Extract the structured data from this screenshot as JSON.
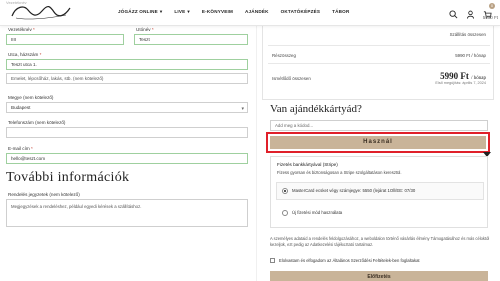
{
  "header": {
    "ghost_label": "Vezetéknév",
    "nav": [
      "JÓGÁZZ ONLINE",
      "LIVE",
      "E-KÖNYVEIM",
      "AJÁNDÉK",
      "OKTATÓKÉPZÉS",
      "TÁBOR"
    ],
    "nav_dropdowns": [
      true,
      true,
      false,
      false,
      false,
      false
    ],
    "cart_count": "0",
    "cart_total": "5990 Ft",
    "icons": [
      "search-icon",
      "user-icon",
      "cart-icon"
    ]
  },
  "form": {
    "lastname_label": "Vezetéknév",
    "firstname_label": "Utónév",
    "lastname_value": "IIII",
    "firstname_value": "Teszt",
    "address_label": "Utca, házszám",
    "address_value": "Teszt utca 1.",
    "address2_placeholder": "Emelet, lépcsőház, lakás, stb. (nem kötelező)",
    "county_label": "Megye (nem kötelező)",
    "county_value": "Budapest",
    "phone_label": "Telefonszám (nem kötelező)",
    "phone_value": "",
    "email_label": "E-mail cím",
    "email_value": "hello@teszt.com",
    "required_mark": "*",
    "section_title": "További információk",
    "notes_label": "Rendelés jegyzetek (nem kötelező)",
    "notes_placeholder": "Megjegyzések a rendeléshez, például egyedi kérések a szállításhoz."
  },
  "summary": {
    "shipping_label": "Szállítás összesen",
    "subscription_label": "Részösszeg",
    "subscription_value": "5990 Ft / hónap",
    "recurring_label": "Ismétlődő összesen",
    "recurring_value": "5990 Ft",
    "recurring_unit": "/ hónap",
    "first_renewal": "Első megújítás: április 7, 2024"
  },
  "gift": {
    "title": "Van ajándékkártyád?",
    "input_placeholder": "Add meg a kódod...",
    "use_button": "Használ"
  },
  "payment": {
    "title": "Fizetés bankkártyával (Stripe)",
    "desc": "Fizess gyorsan és biztonságosan a Stripe szolgáltatáson keresztül.",
    "saved_card": "MasterCard ecsket végy számjegye: 5550 (lejárat 1Oll/EE: 07/30",
    "new_method": "Új fizetési mód használata"
  },
  "footer": {
    "privacy": "A személyes adataid a rendelés feldolgozásához, a weboldalon történő vásárlás élmény Támogatásához és más céloktól kezeljük, ezt pedig az Adatkezelési tájékoztató tartalmaz.",
    "terms": "Elolvastam és elfogadom az Általános Szerződési Feltételek-ben foglaltakat",
    "order_button": "Előfizetés"
  }
}
